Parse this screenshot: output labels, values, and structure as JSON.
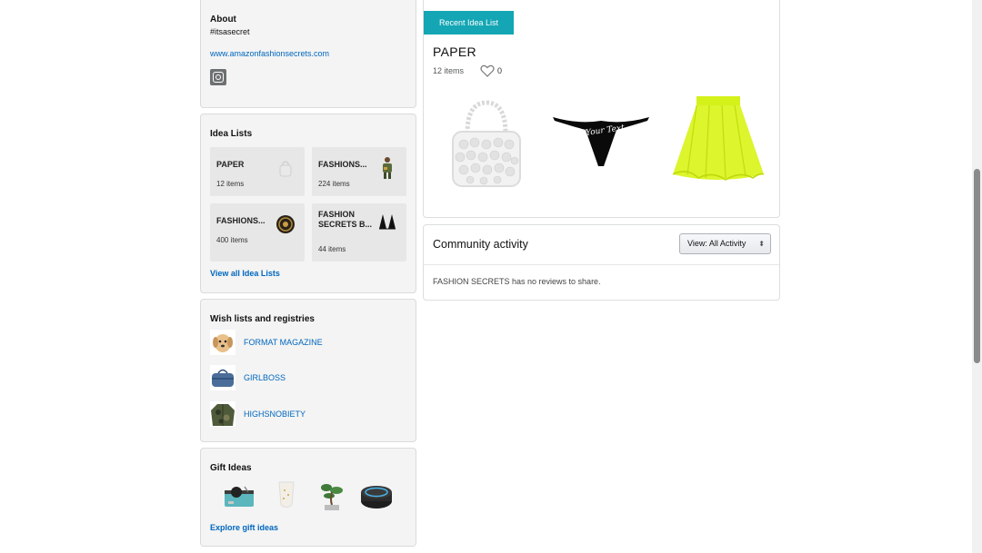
{
  "about": {
    "title": "About",
    "tagline": "#itsasecret",
    "website": "www.amazonfashionsecrets.com",
    "social_icon": "instagram-icon"
  },
  "idea_lists": {
    "title": "Idea Lists",
    "tiles": [
      {
        "name": "PAPER",
        "count": "12 items",
        "thumb": "beaded-bag"
      },
      {
        "name": "FASHIONS...",
        "count": "224 items",
        "thumb": "camo-figure"
      },
      {
        "name": "FASHIONS...",
        "count": "400 items",
        "thumb": "gold-coin"
      },
      {
        "name": "FASHION SECRETS B...",
        "count": "44 items",
        "thumb": "black-bikini-top"
      }
    ],
    "view_all": "View all Idea Lists"
  },
  "wish_lists": {
    "title": "Wish lists and registries",
    "items": [
      {
        "name": "FORMAT MAGAZINE",
        "thumb": "puppy"
      },
      {
        "name": "GIRLBOSS",
        "thumb": "denim-duffel-bag"
      },
      {
        "name": "HIGHSNOBIETY",
        "thumb": "camo-jacket"
      }
    ]
  },
  "gift_ideas": {
    "title": "Gift Ideas",
    "items": [
      "record-player",
      "wine-glass",
      "bonsai-tree",
      "smart-speaker"
    ],
    "explore": "Explore gift ideas"
  },
  "recent_list": {
    "tab_label": "Recent Idea List",
    "title": "PAPER",
    "count": "12 items",
    "likes": "0",
    "products": [
      {
        "name": "white beaded handbag",
        "thumb": "beaded-bag"
      },
      {
        "name": "black custom thong",
        "thumb": "thong",
        "overlay_text": "Your Text"
      },
      {
        "name": "neon petticoat skirt",
        "thumb": "tutu-skirt"
      }
    ]
  },
  "community": {
    "title": "Community activity",
    "view_label": "View:",
    "view_value": "All Activity",
    "empty_message": "FASHION SECRETS has no reviews to share."
  },
  "colors": {
    "tab": "#14a6b4",
    "link": "#0066c0",
    "box_bg": "#f3f4f3"
  }
}
